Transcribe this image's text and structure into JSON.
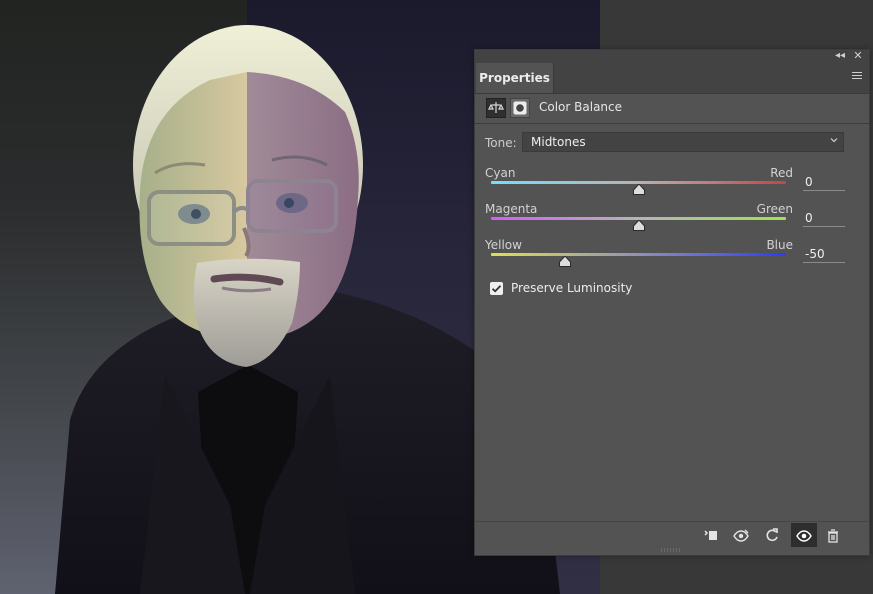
{
  "panel": {
    "tab_title": "Properties",
    "adjustment_title": "Color Balance",
    "tone_label": "Tone:",
    "tone_value": "Midtones",
    "sliders": [
      {
        "left_label": "Cyan",
        "right_label": "Red",
        "value": "0",
        "thumb_fraction": 0.5
      },
      {
        "left_label": "Magenta",
        "right_label": "Green",
        "value": "0",
        "thumb_fraction": 0.5
      },
      {
        "left_label": "Yellow",
        "right_label": "Blue",
        "value": "-50",
        "thumb_fraction": 0.25
      }
    ],
    "preserve_luminosity": {
      "label": "Preserve Luminosity",
      "checked": true
    },
    "footer_icons": [
      "clip-to-layer-icon",
      "view-previous-state-icon",
      "reset-icon",
      "visibility-icon",
      "trash-icon"
    ]
  },
  "colors": {
    "panel_bg": "#535353",
    "panel_header_bg": "#434343",
    "text_primary": "#e6e6e6",
    "slider_cyan_red": [
      "#70e0ff",
      "#c44545"
    ],
    "slider_magenta_green": [
      "#d45cff",
      "#9ee34d"
    ],
    "slider_yellow_blue": [
      "#e0e04b",
      "#2a3cff"
    ]
  }
}
